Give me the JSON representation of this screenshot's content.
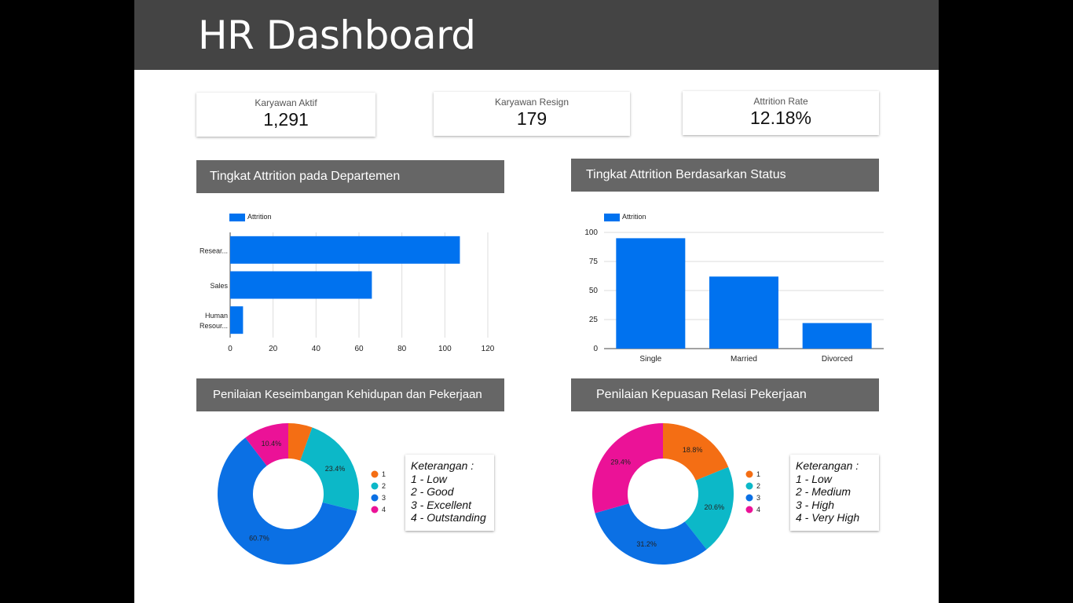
{
  "header": {
    "title": "HR Dashboard"
  },
  "kpis": [
    {
      "label": "Karyawan Aktif",
      "value": "1,291"
    },
    {
      "label": "Karyawan Resign",
      "value": "179"
    },
    {
      "label": "Attrition Rate",
      "value": "12.18%"
    }
  ],
  "sections": {
    "dept": "Tingkat Attrition pada Departemen",
    "status": "Tingkat Attrition Berdasarkan Status",
    "wlb": "Penilaian Keseimbangan Kehidupan dan Pekerjaan",
    "relasi": "Penilaian Kepuasan Relasi Pekerjaan"
  },
  "colors": {
    "header": "#444444",
    "section": "#666666",
    "bar": "#0072EF",
    "pie": [
      "#F46E14",
      "#0CB8C8",
      "#0B70E4",
      "#EB1297"
    ]
  },
  "chart_data": [
    {
      "type": "bar",
      "orientation": "horizontal",
      "legend": [
        "Attrition"
      ],
      "categories": [
        [
          "Resear..."
        ],
        [
          "Sales"
        ],
        [
          "Human",
          "Resour..."
        ]
      ],
      "series": [
        {
          "name": "Attrition",
          "values": [
            107,
            66,
            6
          ]
        }
      ],
      "xlim": [
        0,
        120
      ],
      "xticks": [
        0,
        20,
        40,
        60,
        80,
        100,
        120
      ]
    },
    {
      "type": "bar",
      "legend": [
        "Attrition"
      ],
      "categories": [
        "Single",
        "Married",
        "Divorced"
      ],
      "series": [
        {
          "name": "Attrition",
          "values": [
            95,
            62,
            22
          ]
        }
      ],
      "ylim": [
        0,
        100
      ],
      "yticks": [
        0,
        25,
        50,
        75,
        100
      ]
    },
    {
      "type": "pie",
      "donut": true,
      "labels": [
        "1",
        "2",
        "3",
        "4"
      ],
      "values": [
        5.5,
        23.4,
        60.7,
        10.4
      ],
      "value_labels": [
        "",
        "23.4%",
        "60.7%",
        "10.4%"
      ],
      "note": [
        "Keterangan :",
        "1 - Low",
        "2 - Good",
        "3 - Excellent",
        "4 - Outstanding"
      ]
    },
    {
      "type": "pie",
      "donut": true,
      "labels": [
        "1",
        "2",
        "3",
        "4"
      ],
      "values": [
        18.8,
        20.6,
        31.2,
        29.4
      ],
      "value_labels": [
        "18.8%",
        "20.6%",
        "31.2%",
        "29.4%"
      ],
      "note": [
        "Keterangan :",
        "1 - Low",
        "2 - Medium",
        "3 - High",
        "4 - Very High"
      ]
    }
  ]
}
